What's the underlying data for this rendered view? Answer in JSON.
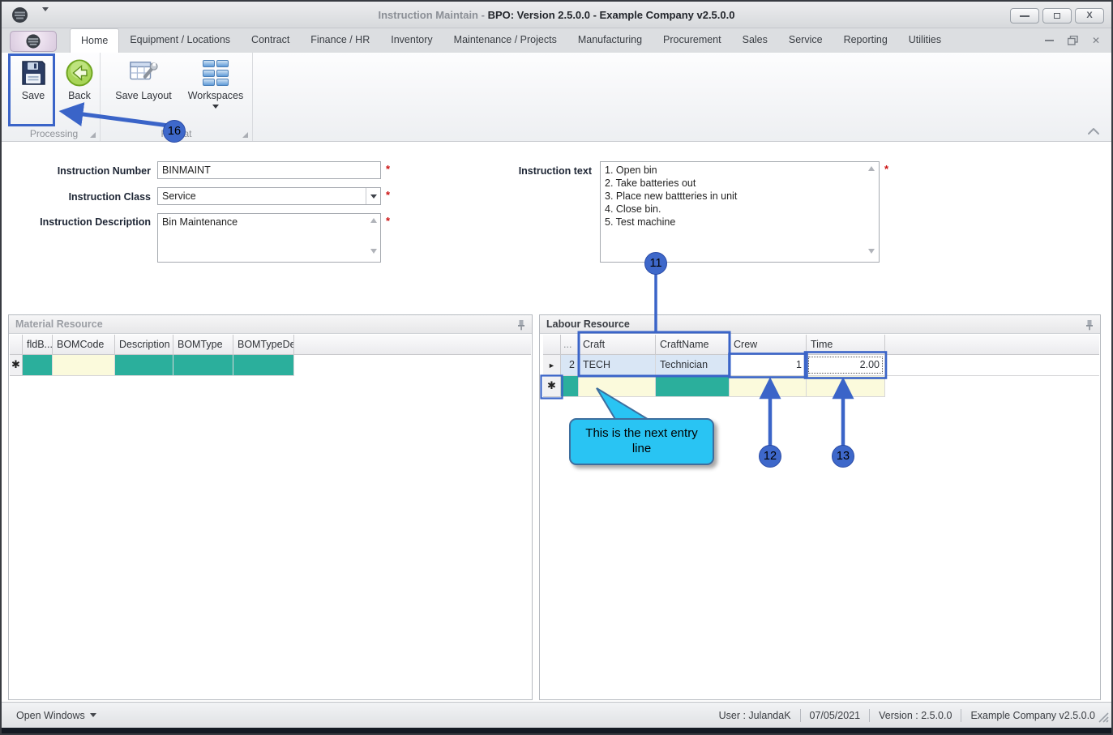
{
  "window": {
    "title_prefix": "Instruction Maintain - ",
    "title_bold": "BPO: Version 2.5.0.0 - Example Company v2.5.0.0"
  },
  "ribbon": {
    "tabs": [
      "Home",
      "Equipment / Locations",
      "Contract",
      "Finance / HR",
      "Inventory",
      "Maintenance / Projects",
      "Manufacturing",
      "Procurement",
      "Sales",
      "Service",
      "Reporting",
      "Utilities"
    ],
    "active_tab": "Home",
    "buttons": {
      "save": "Save",
      "back": "Back",
      "save_layout": "Save Layout",
      "workspaces": "Workspaces"
    },
    "groups": {
      "processing": "Processing",
      "format": "Format"
    }
  },
  "form": {
    "required_marker": "*",
    "instruction_number": {
      "label": "Instruction Number",
      "value": "BINMAINT"
    },
    "instruction_class": {
      "label": "Instruction Class",
      "value": "Service"
    },
    "instruction_description": {
      "label": "Instruction Description",
      "value": "Bin Maintenance"
    },
    "instruction_text": {
      "label": "Instruction text",
      "value": "1. Open bin\n2. Take batteries out\n3. Place new battteries in unit\n4. Close bin.\n5. Test machine"
    }
  },
  "material_panel": {
    "title": "Material Resource",
    "columns": [
      "fldB...",
      "BOMCode",
      "Description",
      "BOMType",
      "BOMTypeDe..."
    ],
    "new_row_indicator": "✱"
  },
  "labour_panel": {
    "title": "Labour Resource",
    "columns": [
      "...",
      "Craft",
      "CraftName",
      "Crew",
      "Time"
    ],
    "row": {
      "indicator": "►",
      "num": "2",
      "craft": "TECH",
      "craft_name": "Technician",
      "crew": "1",
      "time": "2.00"
    },
    "new_row_indicator": "✱"
  },
  "callout": {
    "text": "This is the next entry line"
  },
  "annotations": {
    "n11": "11",
    "n12": "12",
    "n13": "13",
    "n16": "16"
  },
  "status_bar": {
    "open_windows": "Open Windows",
    "user": "User : JulandaK",
    "date": "07/05/2021",
    "version": "Version : 2.5.0.0",
    "company": "Example Company v2.5.0.0"
  },
  "icons": {
    "app": "bpo-logo",
    "save": "floppy-disk",
    "back": "green-arrow-left",
    "save_layout": "table-with-wrench",
    "workspaces": "grid-of-squares",
    "panel_pin": "pushpin",
    "ribbon_collapse": "chevron-up",
    "grid_new_row": "asterisk",
    "grid_current_row": "right-triangle"
  },
  "colors": {
    "annotation_blue": "#3A64C8",
    "callout_cyan": "#29C4F3",
    "cell_teal": "#2BAF9C",
    "cell_yellow": "#FBFADC",
    "row_selected": "#D9E6F5",
    "required_red": "#CC1111"
  }
}
